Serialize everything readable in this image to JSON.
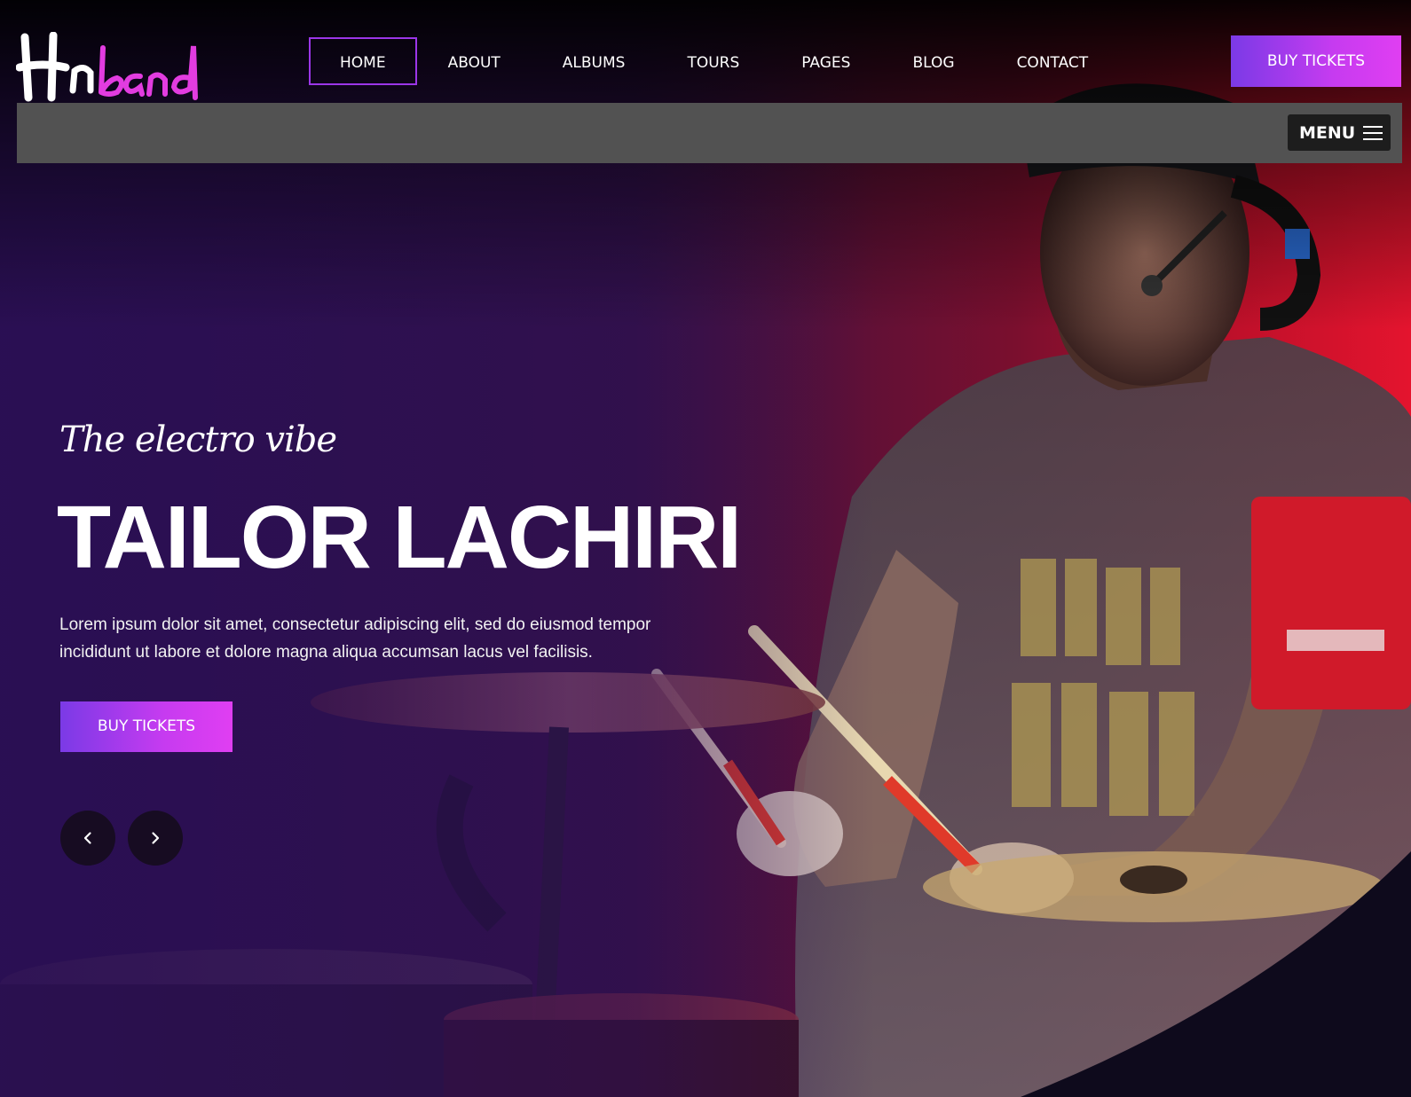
{
  "brand": {
    "logo_text": "Hnband",
    "colors": {
      "accent_start": "#7b3ae6",
      "accent_end": "#e03ef2",
      "menu_bar": "#525252"
    }
  },
  "nav": {
    "items": [
      {
        "label": "HOME",
        "active": true
      },
      {
        "label": "ABOUT"
      },
      {
        "label": "ALBUMS"
      },
      {
        "label": "TOURS"
      },
      {
        "label": "PAGES"
      },
      {
        "label": "BLOG"
      },
      {
        "label": "CONTACT"
      }
    ],
    "cta_label": "BUY TICKETS"
  },
  "menu_bar": {
    "toggle_label": "MENU",
    "toggle_icon": "hamburger-icon"
  },
  "hero": {
    "tagline": "The electro vibe",
    "title": "TAILOR LACHIRI",
    "description": "Lorem ipsum dolor sit amet, consectetur adipiscing elit, sed do eiusmod tempor incididunt ut labore et dolore magna aliqua accumsan lacus vel facilisis.",
    "cta_label": "BUY TICKETS",
    "prev_icon": "chevron-left-icon",
    "next_icon": "chevron-right-icon"
  }
}
